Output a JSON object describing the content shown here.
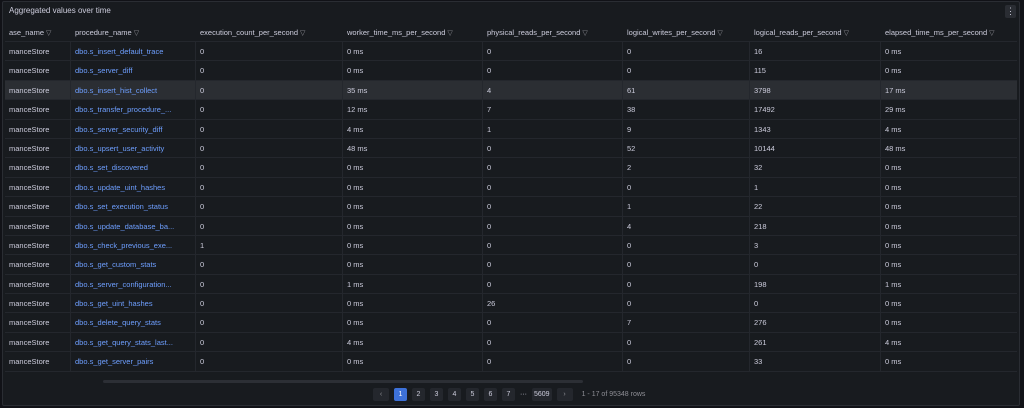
{
  "panel": {
    "title": "Aggregated values over time",
    "menu_icon": "kebab-menu-icon"
  },
  "table": {
    "columns": [
      "ase_name",
      "procedure_name",
      "execution_count_per_second",
      "worker_time_ms_per_second",
      "physical_reads_per_second",
      "logical_writes_per_second",
      "logical_reads_per_second",
      "elapsed_time_ms_per_second"
    ],
    "selected_row": 2,
    "rows": [
      [
        "manceStore",
        "dbo.s_insert_default_trace",
        "0",
        "0 ms",
        "0",
        "0",
        "16",
        "0 ms"
      ],
      [
        "manceStore",
        "dbo.s_server_diff",
        "0",
        "0 ms",
        "0",
        "0",
        "115",
        "0 ms"
      ],
      [
        "manceStore",
        "dbo.s_insert_hist_collect",
        "0",
        "35 ms",
        "4",
        "61",
        "3798",
        "17 ms"
      ],
      [
        "manceStore",
        "dbo.s_transfer_procedure_...",
        "0",
        "12 ms",
        "7",
        "38",
        "17492",
        "29 ms"
      ],
      [
        "manceStore",
        "dbo.s_server_security_diff",
        "0",
        "4 ms",
        "1",
        "9",
        "1343",
        "4 ms"
      ],
      [
        "manceStore",
        "dbo.s_upsert_user_activity",
        "0",
        "48 ms",
        "0",
        "52",
        "10144",
        "48 ms"
      ],
      [
        "manceStore",
        "dbo.s_set_discovered",
        "0",
        "0 ms",
        "0",
        "2",
        "32",
        "0 ms"
      ],
      [
        "manceStore",
        "dbo.s_update_uint_hashes",
        "0",
        "0 ms",
        "0",
        "0",
        "1",
        "0 ms"
      ],
      [
        "manceStore",
        "dbo.s_set_execution_status",
        "0",
        "0 ms",
        "0",
        "1",
        "22",
        "0 ms"
      ],
      [
        "manceStore",
        "dbo.s_update_database_ba...",
        "0",
        "0 ms",
        "0",
        "4",
        "218",
        "0 ms"
      ],
      [
        "manceStore",
        "dbo.s_check_previous_exe...",
        "1",
        "0 ms",
        "0",
        "0",
        "3",
        "0 ms"
      ],
      [
        "manceStore",
        "dbo.s_get_custom_stats",
        "0",
        "0 ms",
        "0",
        "0",
        "0",
        "0 ms"
      ],
      [
        "manceStore",
        "dbo.s_server_configuration...",
        "0",
        "1 ms",
        "0",
        "0",
        "198",
        "1 ms"
      ],
      [
        "manceStore",
        "dbo.s_get_uint_hashes",
        "0",
        "0 ms",
        "26",
        "0",
        "0",
        "0 ms"
      ],
      [
        "manceStore",
        "dbo.s_delete_query_stats",
        "0",
        "0 ms",
        "0",
        "7",
        "276",
        "0 ms"
      ],
      [
        "manceStore",
        "dbo.s_get_query_stats_last...",
        "0",
        "4 ms",
        "0",
        "0",
        "261",
        "4 ms"
      ],
      [
        "manceStore",
        "dbo.s_get_server_pairs",
        "0",
        "0 ms",
        "0",
        "0",
        "33",
        "0 ms"
      ]
    ]
  },
  "pagination": {
    "prev": "‹",
    "next": "›",
    "pages": [
      "1",
      "2",
      "3",
      "4",
      "5",
      "6",
      "7"
    ],
    "ellipsis": "···",
    "last_page": "5609",
    "current": "1",
    "summary": "1 - 17 of 95348 rows"
  },
  "colors": {
    "link": "#6e9fff",
    "active_page": "#3d71d9",
    "panel_bg": "#181b1f"
  }
}
